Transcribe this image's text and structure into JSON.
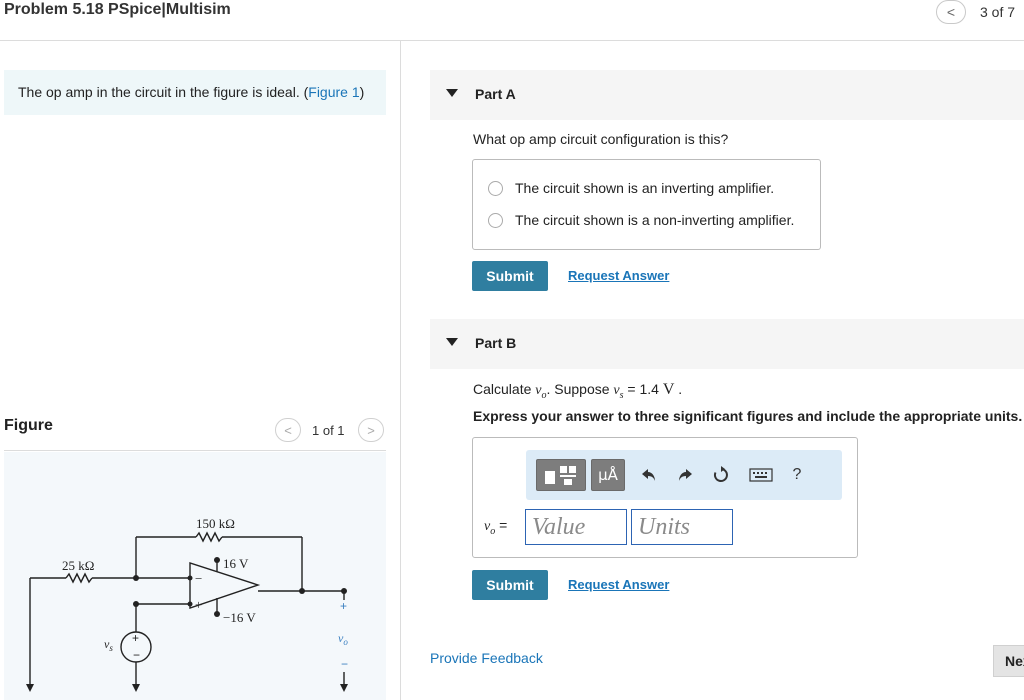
{
  "header": {
    "title": "Problem 5.18 PSpice|Multisim",
    "nav_prev": "<",
    "page_count": "3 of 7"
  },
  "problem": {
    "statement_prefix": "The op amp in the circuit in the figure is ideal. (",
    "figure_link": "Figure 1",
    "statement_suffix": ")"
  },
  "figure": {
    "label": "Figure",
    "prev": "<",
    "next": ">",
    "count": "1 of 1",
    "labels": {
      "r_feedback": "150 kΩ",
      "r_input": "25 kΩ",
      "v_pos": "16 V",
      "v_neg": "−16 V",
      "minus_sign": "−",
      "plus_sign": "+",
      "source": "v",
      "source_sub": "s",
      "out_plus": "+",
      "out_minus": "−",
      "out_v": "v",
      "out_sub": "o"
    }
  },
  "part_a": {
    "label": "Part A",
    "question": "What op amp circuit configuration is this?",
    "options": [
      "The circuit shown is an inverting amplifier.",
      "The circuit shown is a non-inverting amplifier."
    ],
    "submit": "Submit",
    "request_answer": "Request Answer"
  },
  "part_b": {
    "label": "Part B",
    "calc_prefix": "Calculate ",
    "calc_var": "v",
    "calc_var_sub": "o",
    "calc_mid": ". Suppose ",
    "calc_var2": "v",
    "calc_var2_sub": "s",
    "calc_value": " = 1.4 ",
    "calc_unit": "V",
    "calc_end": " .",
    "instruction": "Express your answer to three significant figures and include the appropriate units.",
    "toolbar": {
      "units_label": "μÅ",
      "help": "?"
    },
    "answer_var": "v",
    "answer_var_sub": "o",
    "answer_eq": " =",
    "value_placeholder": "Value",
    "units_placeholder": "Units",
    "submit": "Submit",
    "request_answer": "Request Answer"
  },
  "footer": {
    "feedback": "Provide Feedback",
    "next": "Next"
  },
  "colors": {
    "link": "#1a75b8",
    "submit": "#2f7ea0",
    "toolbar": "#dcebf7",
    "input_border": "#2d64b3"
  }
}
